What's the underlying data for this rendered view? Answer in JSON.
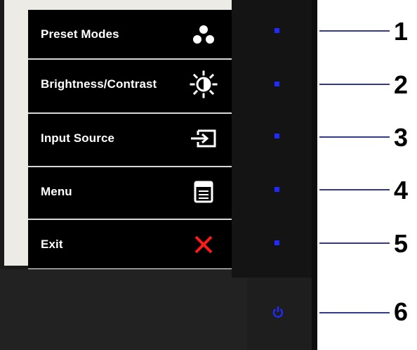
{
  "osd_menu": {
    "items": [
      {
        "label": "Preset Modes",
        "icon": "preset-modes-icon"
      },
      {
        "label": "Brightness/Contrast",
        "icon": "brightness-icon"
      },
      {
        "label": "Input Source",
        "icon": "input-source-icon"
      },
      {
        "label": "Menu",
        "icon": "menu-icon"
      },
      {
        "label": "Exit",
        "icon": "exit-icon"
      }
    ]
  },
  "hardware_buttons": [
    {
      "number": "1",
      "indicator": "led"
    },
    {
      "number": "2",
      "indicator": "led"
    },
    {
      "number": "3",
      "indicator": "led"
    },
    {
      "number": "4",
      "indicator": "led"
    },
    {
      "number": "5",
      "indicator": "led"
    },
    {
      "number": "6",
      "indicator": "power-icon"
    }
  ],
  "colors": {
    "led": "#1f2bff",
    "exit_icon": "#ff1a1a",
    "callout_line": "#333a8a",
    "osd_background": "#000000",
    "osd_text": "#ffffff"
  }
}
